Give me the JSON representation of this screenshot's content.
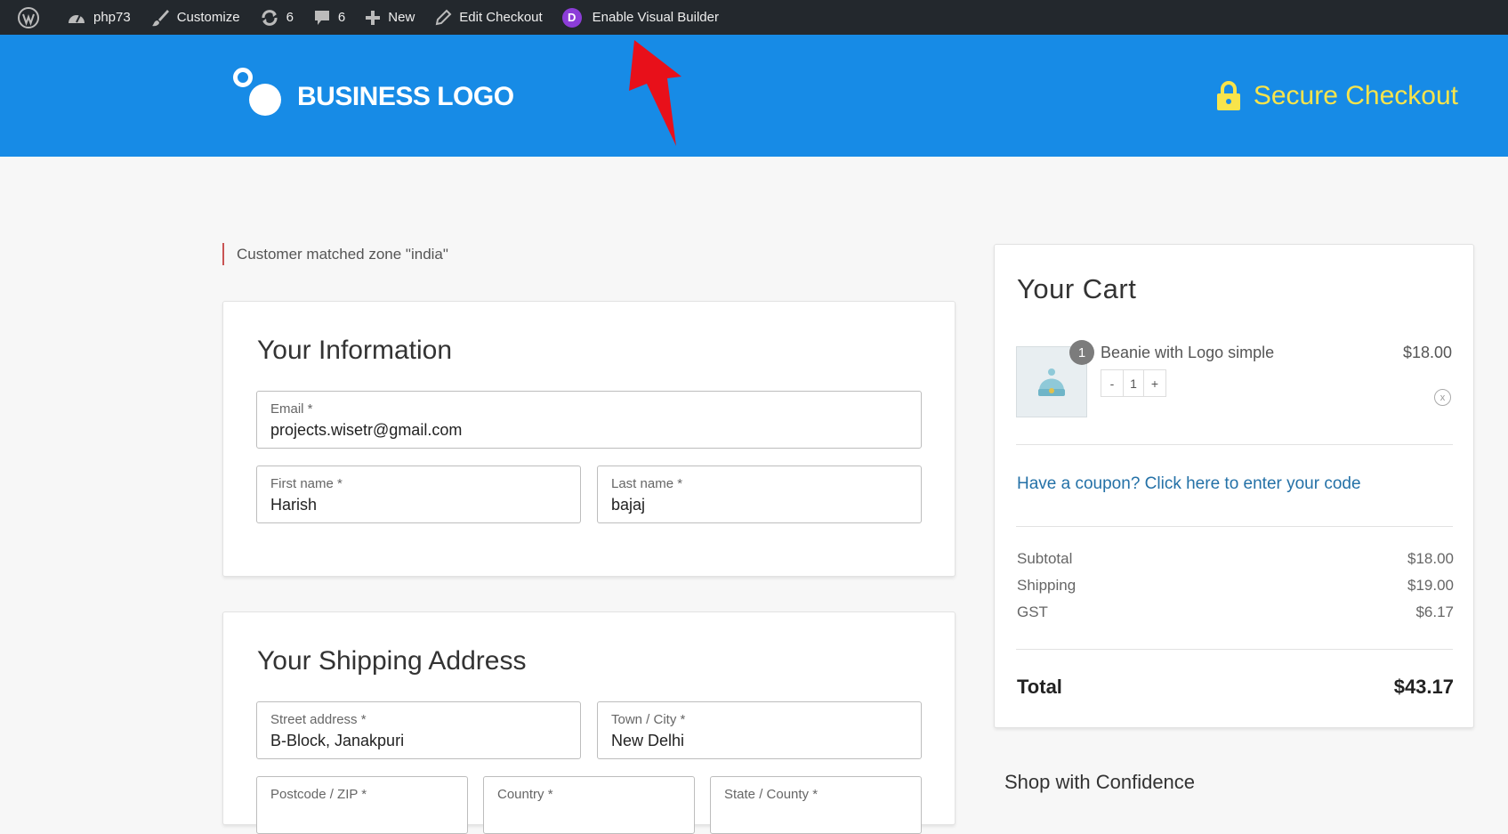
{
  "admin_bar": {
    "site_name": "php73",
    "customize": "Customize",
    "updates_count": "6",
    "comments_count": "6",
    "new": "New",
    "edit": "Edit Checkout",
    "divi_letter": "D",
    "visual_builder": "Enable Visual Builder"
  },
  "header": {
    "logo_text": "BUSINESS LOGO",
    "secure": "Secure Checkout",
    "colors": {
      "bar": "#178be6",
      "secure": "#f8e44b"
    }
  },
  "notice": "Customer matched zone \"india\"",
  "info": {
    "title": "Your Information",
    "email_label": "Email *",
    "email": "projects.wisetr@gmail.com",
    "first_label": "First name *",
    "first": "Harish",
    "last_label": "Last name *",
    "last": "bajaj"
  },
  "shipping": {
    "title": "Your Shipping Address",
    "street_label": "Street address *",
    "street": "B-Block, Janakpuri",
    "city_label": "Town / City *",
    "city": "New Delhi",
    "postcode_label": "Postcode / ZIP *",
    "country_label": "Country *",
    "state_label": "State / County *"
  },
  "cart": {
    "title": "Your Cart",
    "item": {
      "qty_badge": "1",
      "name": "Beanie with Logo simple",
      "price": "$18.00",
      "minus": "-",
      "qty": "1",
      "plus": "+",
      "remove": "x"
    },
    "coupon": "Have a coupon? Click here to enter your code",
    "subtotal_label": "Subtotal",
    "subtotal": "$18.00",
    "shipping_label": "Shipping",
    "shipping": "$19.00",
    "gst_label": "GST",
    "gst": "$6.17",
    "total_label": "Total",
    "total": "$43.17"
  },
  "confidence": "Shop with Confidence"
}
